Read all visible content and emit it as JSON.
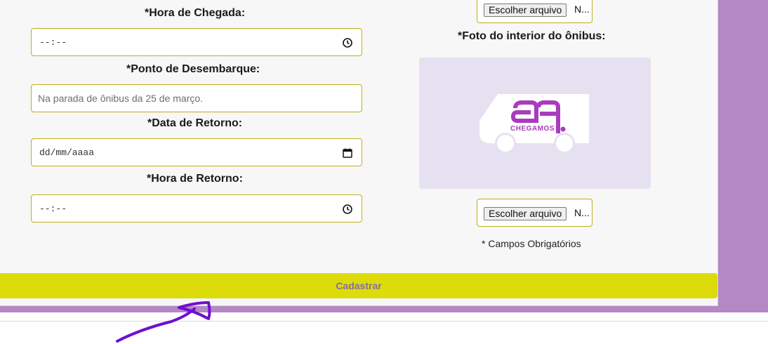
{
  "form": {
    "arrival_time": {
      "label": "*Hora de Chegada:",
      "value": "--:--"
    },
    "dropoff_point": {
      "label": "*Ponto de Desembarque:",
      "placeholder": "Na parada de ônibus da 25 de março."
    },
    "return_date": {
      "label": "*Data de Retorno:",
      "value": "dd/mm/aaaa"
    },
    "return_time": {
      "label": "*Hora de Retorno:",
      "value": "--:--"
    }
  },
  "photos": {
    "top_file": {
      "button": "Escolher arquivo",
      "name": "N..."
    },
    "interior": {
      "label": "*Foto do interior do ônibus:",
      "logo_text": "CHEGAMOS",
      "file": {
        "button": "Escolher arquivo",
        "name": "N..."
      }
    }
  },
  "required_note": "* Campos Obrigatórios",
  "submit_label": "Cadastrar",
  "colors": {
    "page_purple": "#b388c4",
    "accent_yellow": "#dcdc0a",
    "submit_text": "#8b6aa8",
    "field_border": "#bfae1c",
    "logo_purple": "#a93bbd",
    "annotation_purple": "#6f0fd0"
  },
  "icons": [
    "clock-icon",
    "calendar-icon",
    "bus-logo-icon",
    "arrow-annotation-icon"
  ]
}
